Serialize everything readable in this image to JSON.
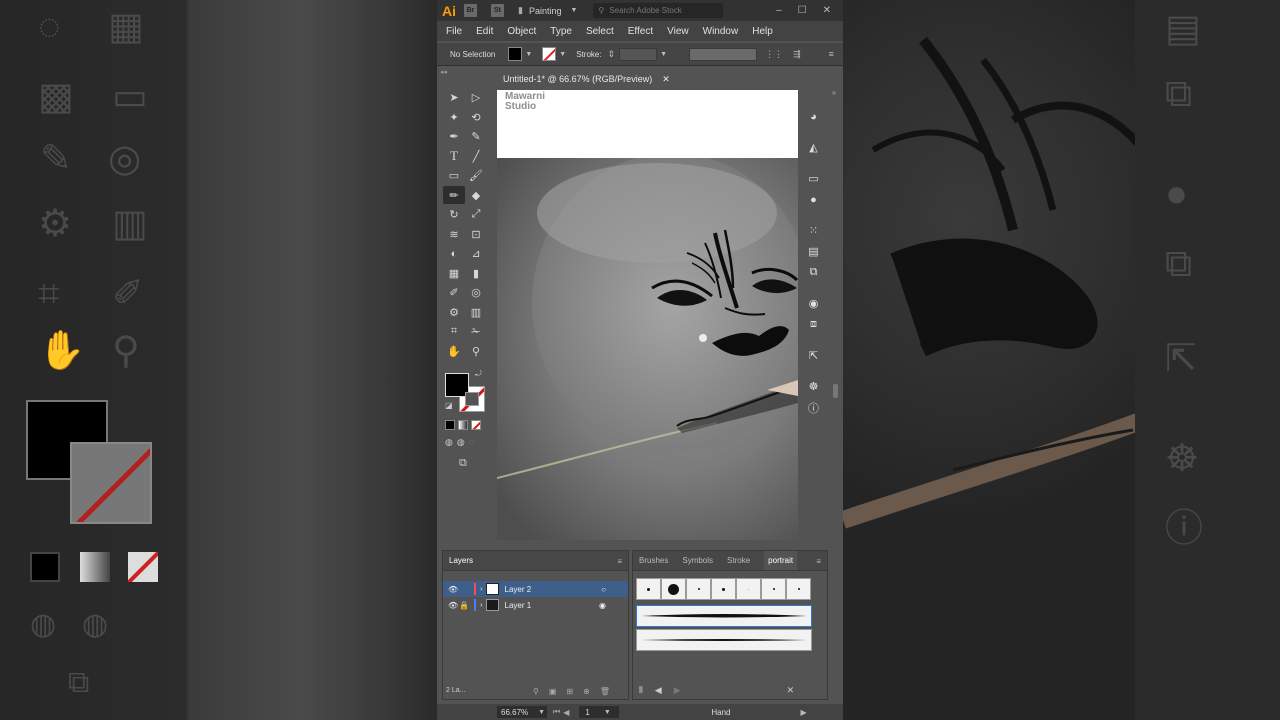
{
  "app": {
    "logo": "Ai",
    "bridge_label": "Br",
    "stock_label": "St",
    "workspace": "Painting",
    "stock_search_placeholder": "Search Adobe Stock",
    "window_controls": [
      "minimize-icon",
      "maximize-icon",
      "close-icon"
    ]
  },
  "menu": [
    "File",
    "Edit",
    "Object",
    "Type",
    "Select",
    "Effect",
    "View",
    "Window",
    "Help"
  ],
  "control_bar": {
    "selection_label": "No Selection",
    "fill_color": "#000000",
    "stroke_label": "Stroke:"
  },
  "document": {
    "tab_title": "Untitled-1* @ 66.67% (RGB/Preview)",
    "watermark_line1": "Mawarni",
    "watermark_line2": "Studio"
  },
  "layers_panel": {
    "tab": "Layers",
    "layers": [
      {
        "name": "Layer 2",
        "selected": true,
        "color": "#ff4b4b"
      },
      {
        "name": "Layer 1",
        "selected": false,
        "color": "#4b7bff"
      }
    ],
    "footer_count": "2 La..."
  },
  "brush_panel": {
    "tabs": [
      "Brushes",
      "Symbols",
      "Stroke",
      "portrait"
    ],
    "active_tab": "portrait"
  },
  "status_bar": {
    "zoom": "66.67%",
    "page": "1",
    "tool": "Hand"
  },
  "colors": {
    "accent_select": "#3d5f8a",
    "ai_orange": "#ff9a00",
    "watermark_pink": "#c63fc8"
  }
}
